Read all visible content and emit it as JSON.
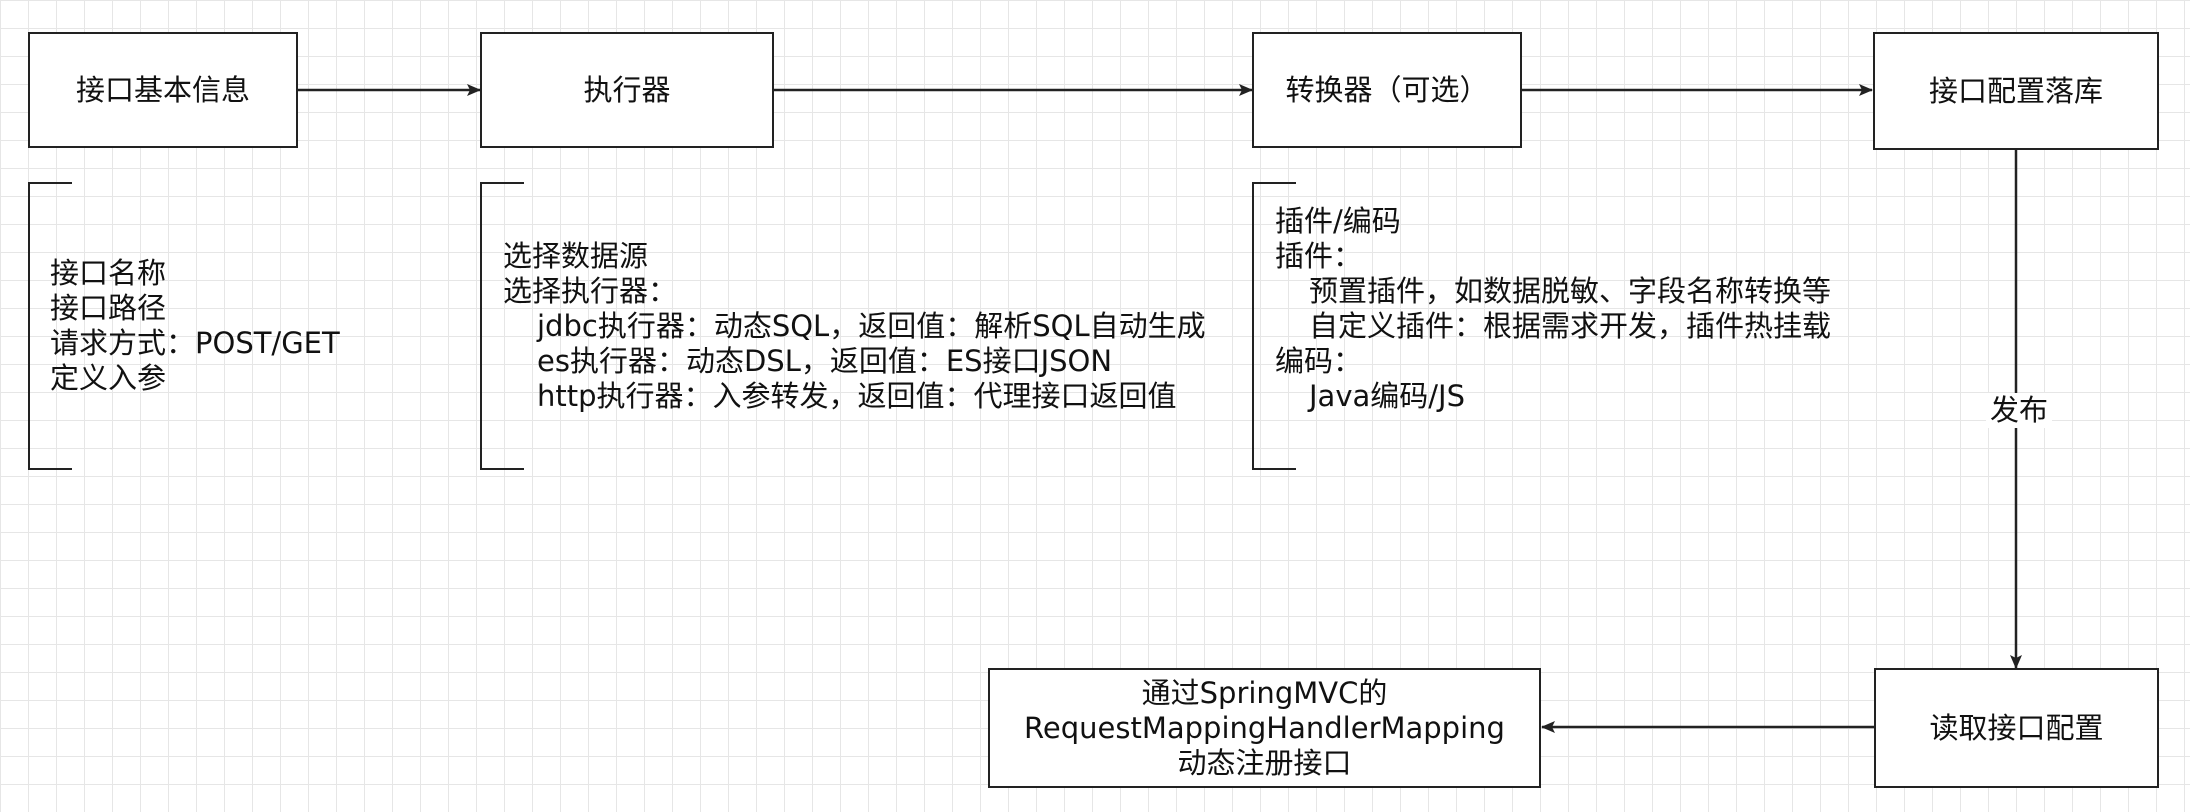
{
  "nodes": {
    "basic_info": "接口基本信息",
    "executor": "执行器",
    "converter": "转换器（可选）",
    "persist": "接口配置落库",
    "read_config": "读取接口配置",
    "register": [
      "通过SpringMVC的",
      "RequestMappingHandlerMapping",
      "动态注册接口"
    ]
  },
  "notes": {
    "basic_info": [
      "接口名称",
      "接口路径",
      "请求方式：POST/GET",
      "定义入参"
    ],
    "executor": [
      "选择数据源",
      "选择执行器：",
      "jdbc执行器：动态SQL，返回值：解析SQL自动生成",
      "es执行器：动态DSL，返回值：ES接口JSON",
      "http执行器：入参转发，返回值：代理接口返回值"
    ],
    "converter": [
      "插件/编码",
      "插件：",
      "预置插件，如数据脱敏、字段名称转换等",
      "自定义插件：根据需求开发，插件热挂载",
      "编码：",
      "Java编码/JS"
    ]
  },
  "edge_labels": {
    "publish": "发布"
  },
  "colors": {
    "stroke": "#222222",
    "grid": "#e6e6e6",
    "background": "#ffffff"
  }
}
